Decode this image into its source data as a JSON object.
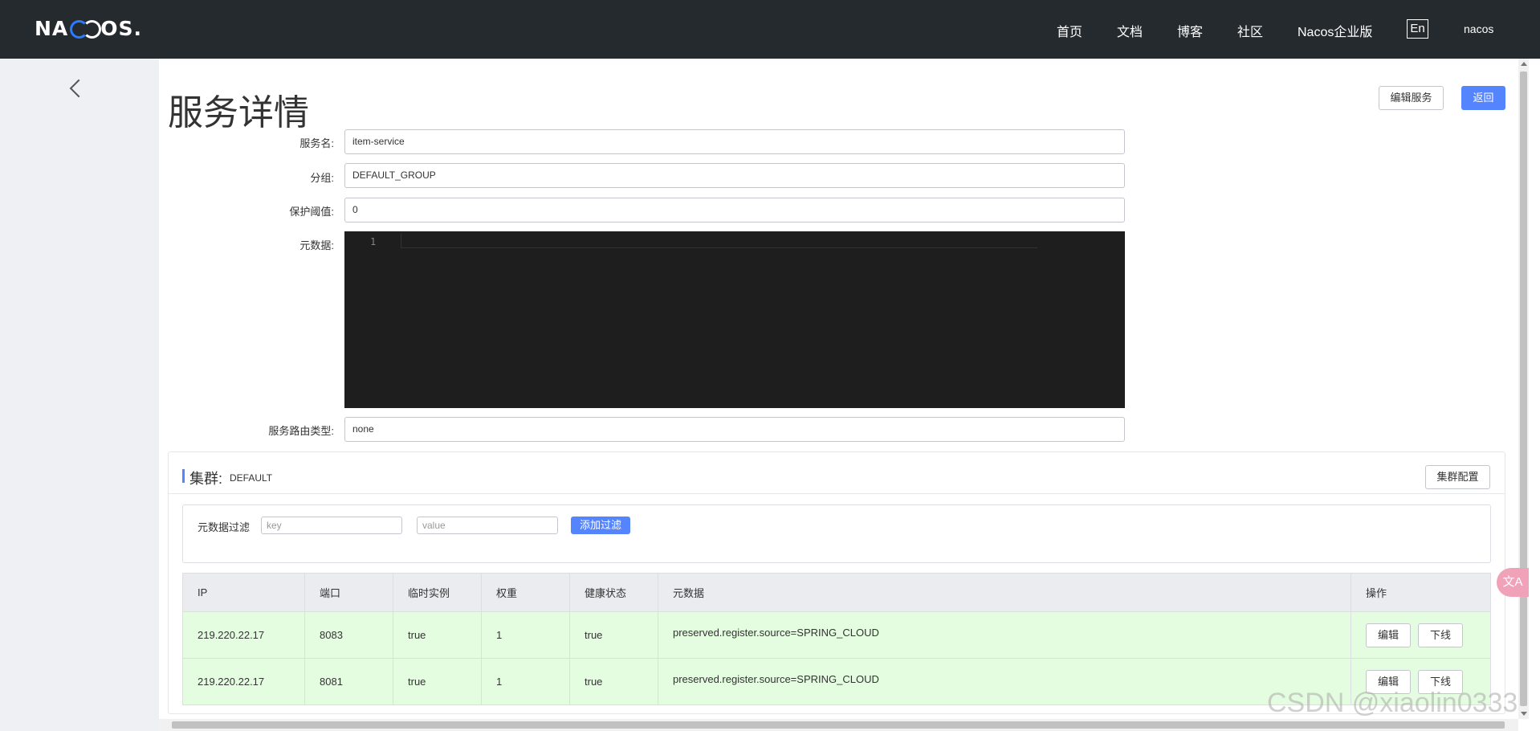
{
  "header": {
    "logo_text": "NACOS.",
    "nav": [
      "首页",
      "文档",
      "博客",
      "社区",
      "Nacos企业版"
    ],
    "lang": "En",
    "user": "nacos"
  },
  "page": {
    "title": "服务详情",
    "edit_service_label": "编辑服务",
    "back_label": "返回"
  },
  "form": {
    "service_name_label": "服务名:",
    "service_name_value": "item-service",
    "group_label": "分组:",
    "group_value": "DEFAULT_GROUP",
    "threshold_label": "保护阈值:",
    "threshold_value": "0",
    "metadata_label": "元数据:",
    "editor_line_number": "1",
    "route_type_label": "服务路由类型:",
    "route_type_value": "none"
  },
  "cluster": {
    "title": "集群:",
    "name": "DEFAULT",
    "config_label": "集群配置",
    "filter_label": "元数据过滤",
    "key_placeholder": "key",
    "value_placeholder": "value",
    "add_filter_label": "添加过滤"
  },
  "table": {
    "columns": [
      "IP",
      "端口",
      "临时实例",
      "权重",
      "健康状态",
      "元数据",
      "操作"
    ],
    "rows": [
      {
        "ip": "219.220.22.17",
        "port": "8083",
        "ephemeral": "true",
        "weight": "1",
        "healthy": "true",
        "metadata": "preserved.register.source=SPRING_CLOUD"
      },
      {
        "ip": "219.220.22.17",
        "port": "8081",
        "ephemeral": "true",
        "weight": "1",
        "healthy": "true",
        "metadata": "preserved.register.source=SPRING_CLOUD"
      }
    ],
    "edit_label": "编辑",
    "offline_label": "下线"
  },
  "watermark": "CSDN @xiaolin0333",
  "colors": {
    "header_bg": "#252a2f",
    "primary": "#5584ff",
    "row_healthy": "#e4fde0",
    "sidebar_bg": "#eef0f3"
  }
}
